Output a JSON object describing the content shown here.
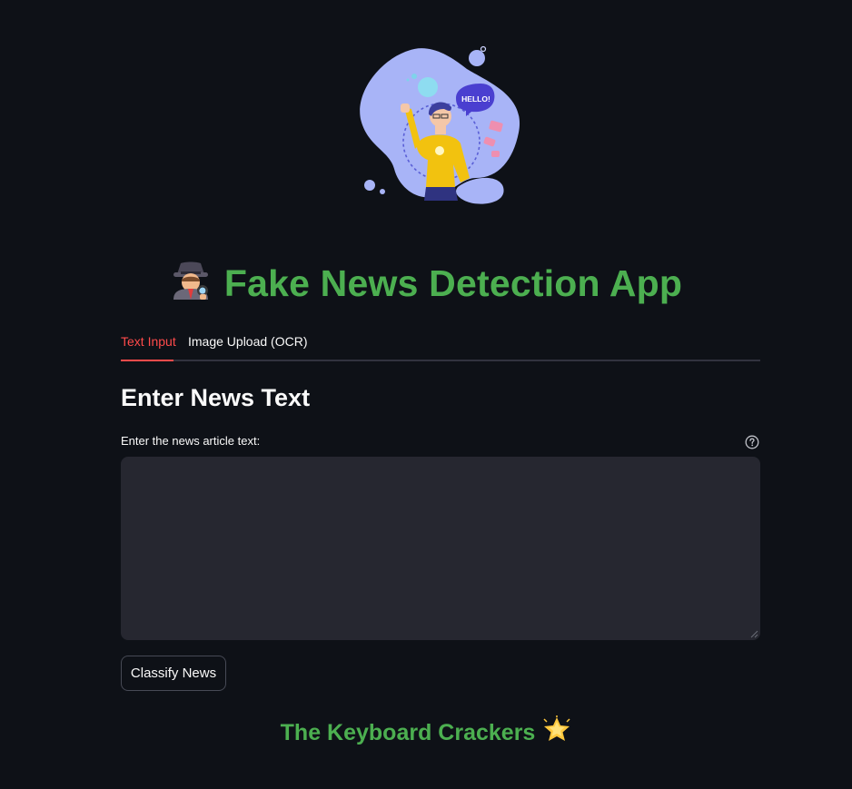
{
  "hero": {
    "speech_bubble_text": "HELLO!"
  },
  "header": {
    "title_icon": "detective-icon",
    "title": "Fake News Detection App"
  },
  "tabs": [
    {
      "label": "Text Input",
      "active": true
    },
    {
      "label": "Image Upload (OCR)",
      "active": false
    }
  ],
  "main": {
    "section_title": "Enter News Text",
    "field_label": "Enter the news article text:",
    "textarea_value": "",
    "help_icon": "question-circle-icon",
    "classify_button_label": "Classify News"
  },
  "footer": {
    "text": "The Keyboard Crackers",
    "icon": "glowing-star-icon"
  },
  "colors": {
    "background": "#0e1117",
    "accent_green": "#4caf50",
    "tab_active": "#ff4b4b",
    "input_bg": "#262730"
  }
}
